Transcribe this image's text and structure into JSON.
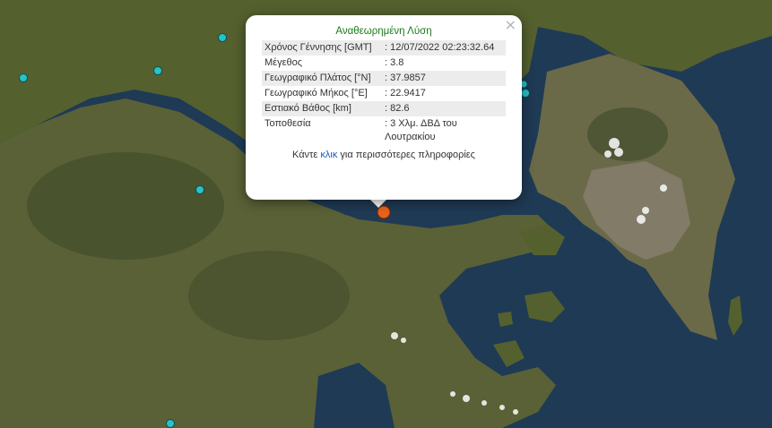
{
  "map": {
    "colors": {
      "sea": "#1f3a55",
      "land": "#5a6136",
      "land_dark": "#3e4a2a",
      "urban": "#8a8273",
      "station": "#28c2c8",
      "epicenter": "#e8641e"
    }
  },
  "popup": {
    "close_label": "×",
    "title": "Αναθεωρημένη Λύση",
    "rows": [
      {
        "label": "Χρόνος Γέννησης [GMT]",
        "value": ": 12/07/2022 02:23:32.64"
      },
      {
        "label": "Μέγεθος",
        "value": ": 3.8"
      },
      {
        "label": "Γεωγραφικό Πλάτος [°N]",
        "value": ": 37.9857"
      },
      {
        "label": "Γεωγραφικό Μήκος [°E]",
        "value": ": 22.9417"
      },
      {
        "label": "Εστιακό Βάθος [km]",
        "value": ": 82.6"
      },
      {
        "label": "Τοποθεσία",
        "value": ": 3 Χλμ. ΔΒΔ του Λουτρακίου"
      }
    ],
    "footer_pre": "Κάντε ",
    "footer_link": "κλικ",
    "footer_post": " για περισσότερες πληροφορίες"
  }
}
